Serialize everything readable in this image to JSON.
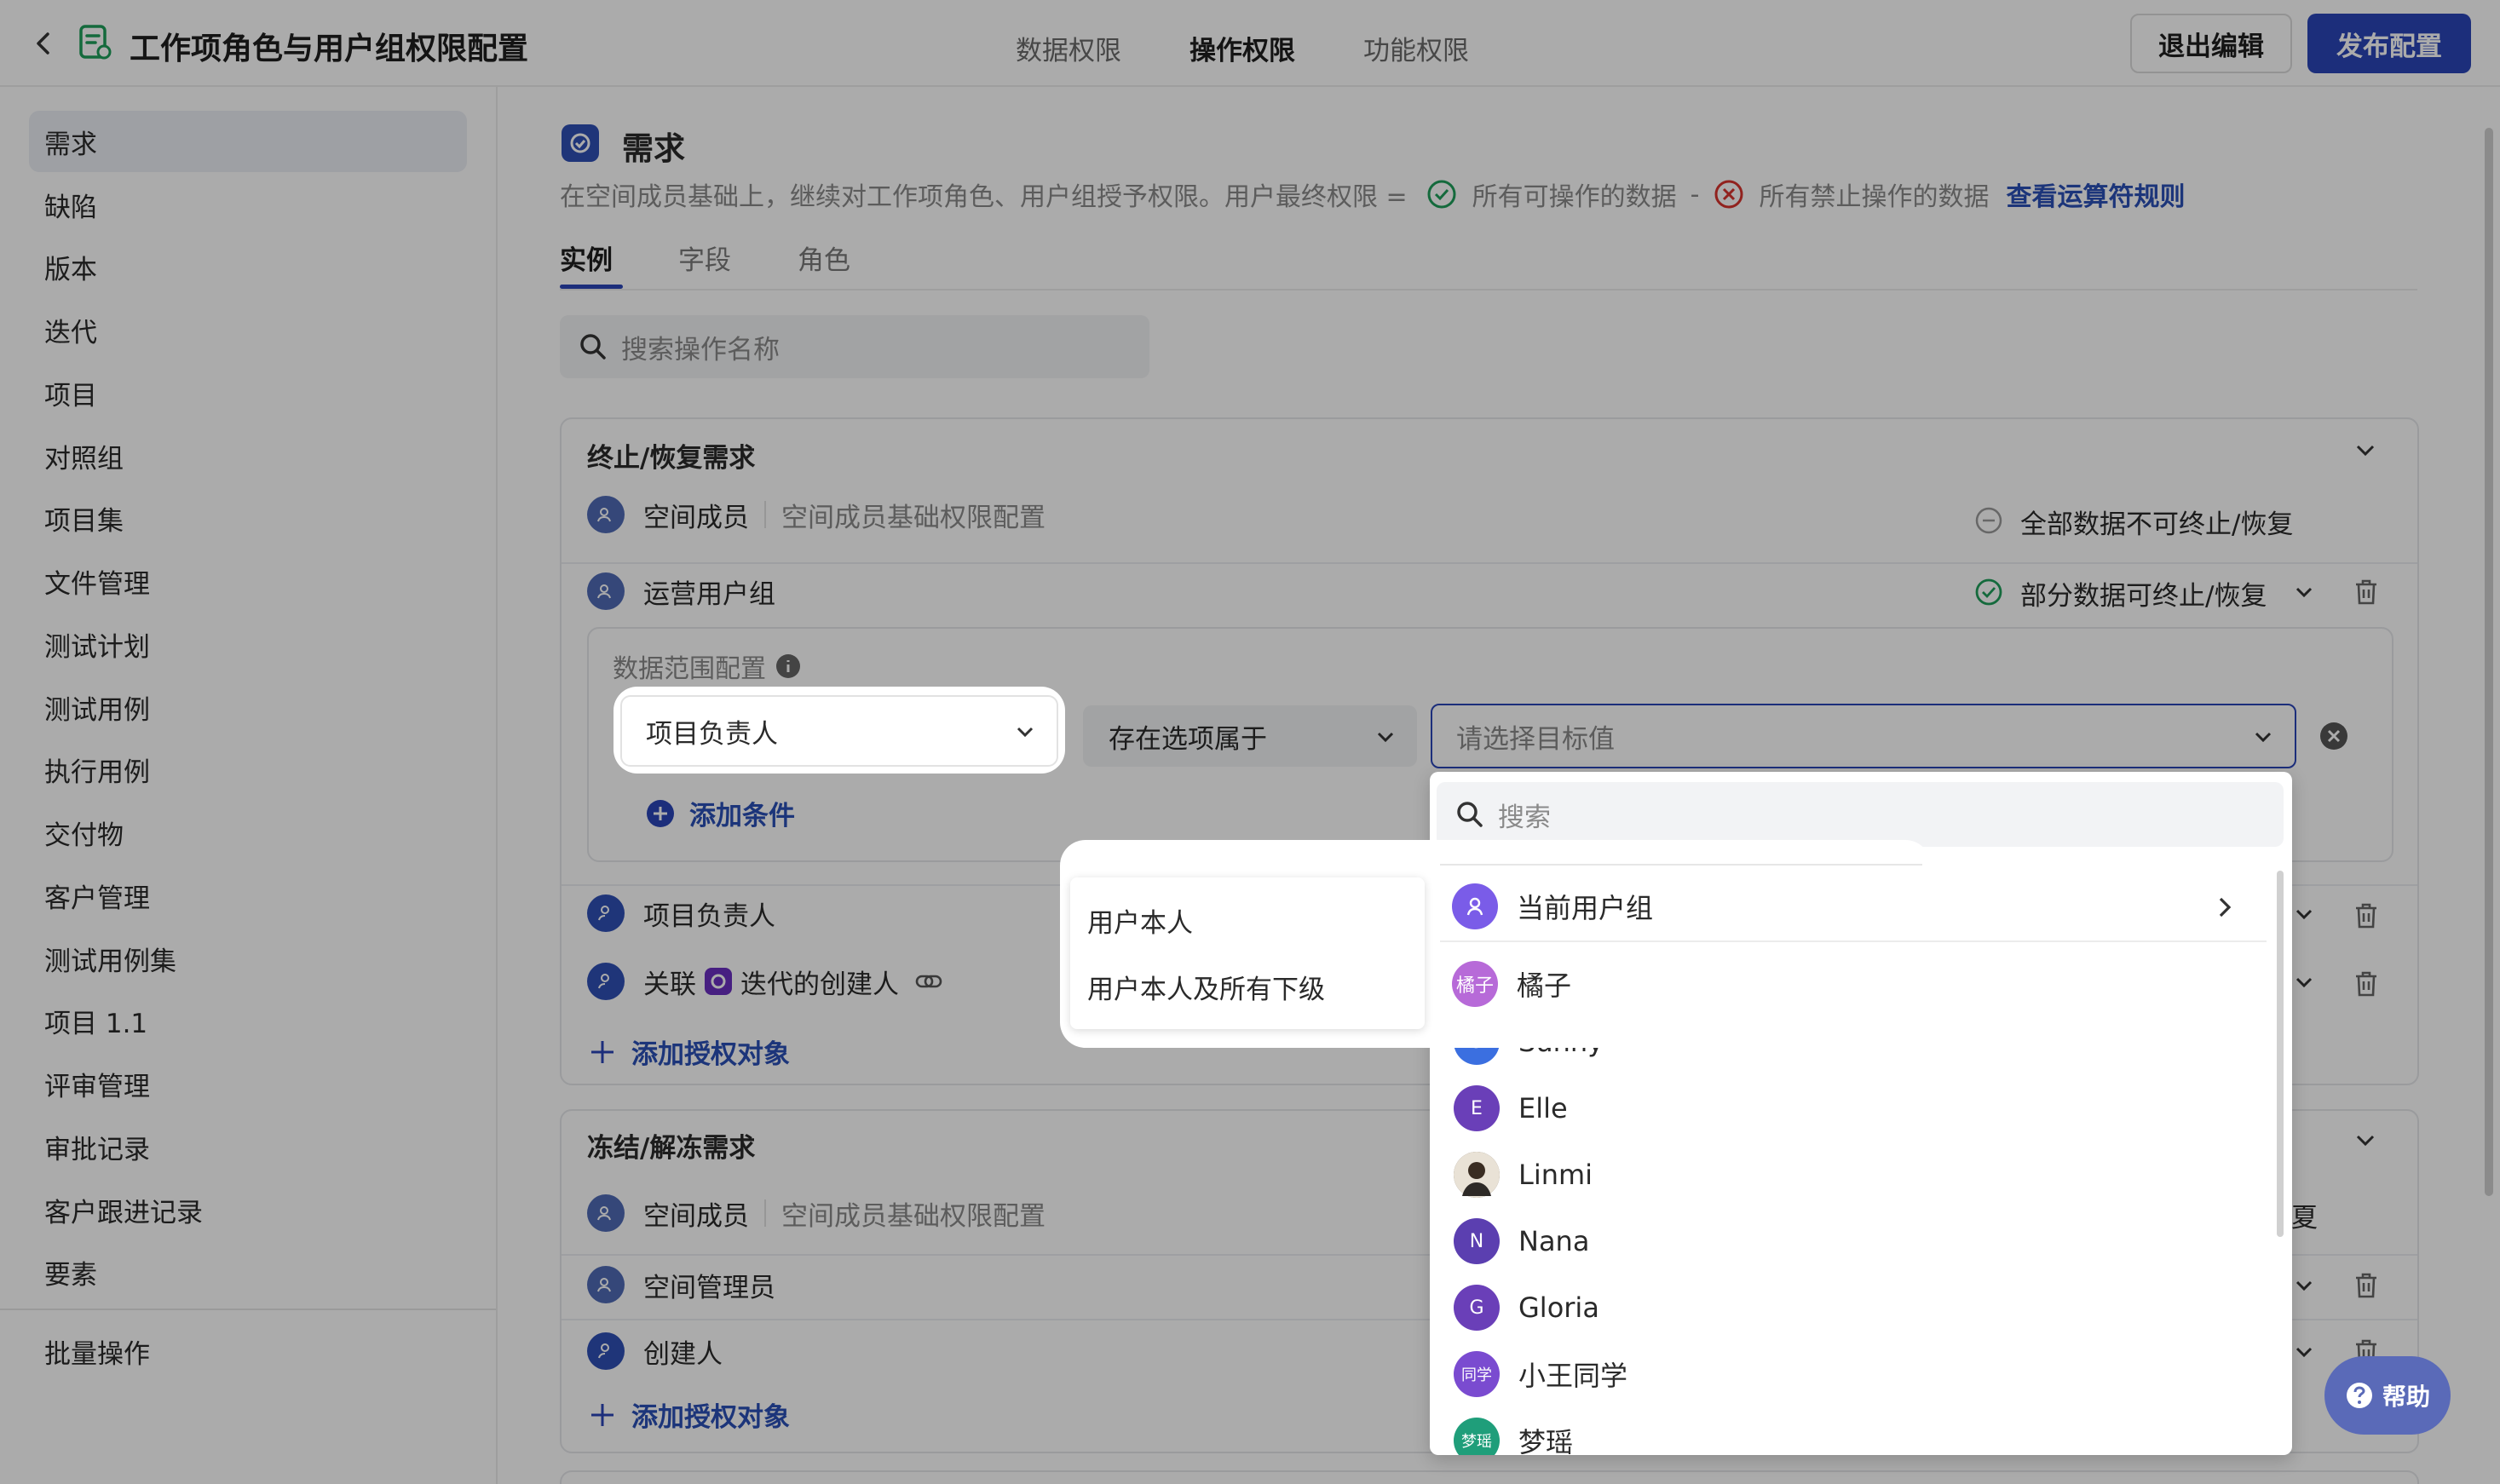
{
  "header": {
    "title": "工作项角色与用户组权限配置",
    "tabs": [
      {
        "label": "数据权限",
        "active": false
      },
      {
        "label": "操作权限",
        "active": true
      },
      {
        "label": "功能权限",
        "active": false
      }
    ],
    "exit_label": "退出编辑",
    "publish_label": "发布配置"
  },
  "sidebar": {
    "items": [
      "需求",
      "缺陷",
      "版本",
      "迭代",
      "项目",
      "对照组",
      "项目集",
      "文件管理",
      "测试计划",
      "测试用例",
      "执行用例",
      "交付物",
      "客户管理",
      "测试用例集",
      "项目 1.1",
      "评审管理",
      "审批记录",
      "客户跟进记录",
      "要素"
    ],
    "active_index": 0,
    "bottom_item": "批量操作"
  },
  "section": {
    "title": "需求",
    "desc_prefix": "在空间成员基础上，继续对工作项角色、用户组授予权限。用户最终权限 =",
    "allowed_text": "所有可操作的数据",
    "minus": "-",
    "forbidden_text": "所有禁止操作的数据",
    "rule_link": "查看运算符规则",
    "subtabs": [
      {
        "label": "实例",
        "active": true
      },
      {
        "label": "字段",
        "active": false
      },
      {
        "label": "角色",
        "active": false
      }
    ],
    "search_placeholder": "搜索操作名称"
  },
  "card1": {
    "title": "终止/恢复需求",
    "row_member": {
      "name": "空间成员",
      "note": "空间成员基础权限配置",
      "status": "全部数据不可终止/恢复"
    },
    "row_ops": {
      "name": "运营用户组",
      "status": "部分数据可终止/恢复"
    },
    "scope": {
      "label": "数据范围配置",
      "field_value": "项目负责人",
      "operator_value": "存在选项属于",
      "target_placeholder": "请选择目标值",
      "add_condition": "添加条件"
    },
    "row_owner": {
      "name": "项目负责人"
    },
    "row_linked": {
      "prefix": "关联",
      "name": "迭代的创建人"
    },
    "add_object": "添加授权对象"
  },
  "card2": {
    "title": "冻结/解冻需求",
    "row_member": {
      "name": "空间成员",
      "note": "空间成员基础权限配置",
      "status_tail": "夏"
    },
    "row_admin": {
      "name": "空间管理员"
    },
    "row_creator": {
      "name": "创建人"
    },
    "add_object": "添加授权对象"
  },
  "dropdown": {
    "search_placeholder": "搜索",
    "current_group": "当前用户组",
    "users": [
      {
        "name": "橘子",
        "badge": "橘子",
        "color": "#b76ad8"
      },
      {
        "name": "Sunny",
        "badge": "S",
        "color": "#3b6fe0"
      },
      {
        "name": "Elle",
        "badge": "E",
        "color": "#6a3fb8"
      },
      {
        "name": "Linmi",
        "badge": "",
        "color": "#5a4a3a"
      },
      {
        "name": "Nana",
        "badge": "N",
        "color": "#5b3fb0"
      },
      {
        "name": "Gloria",
        "badge": "G",
        "color": "#6a3fb8"
      },
      {
        "name": "小王同学",
        "badge": "同学",
        "color": "#7a4bd0"
      },
      {
        "name": "梦瑶",
        "badge": "梦瑶",
        "color": "#1f9e7a"
      }
    ]
  },
  "submenu": {
    "items": [
      "用户本人",
      "用户本人及所有下级"
    ]
  },
  "help": {
    "label": "帮助"
  }
}
